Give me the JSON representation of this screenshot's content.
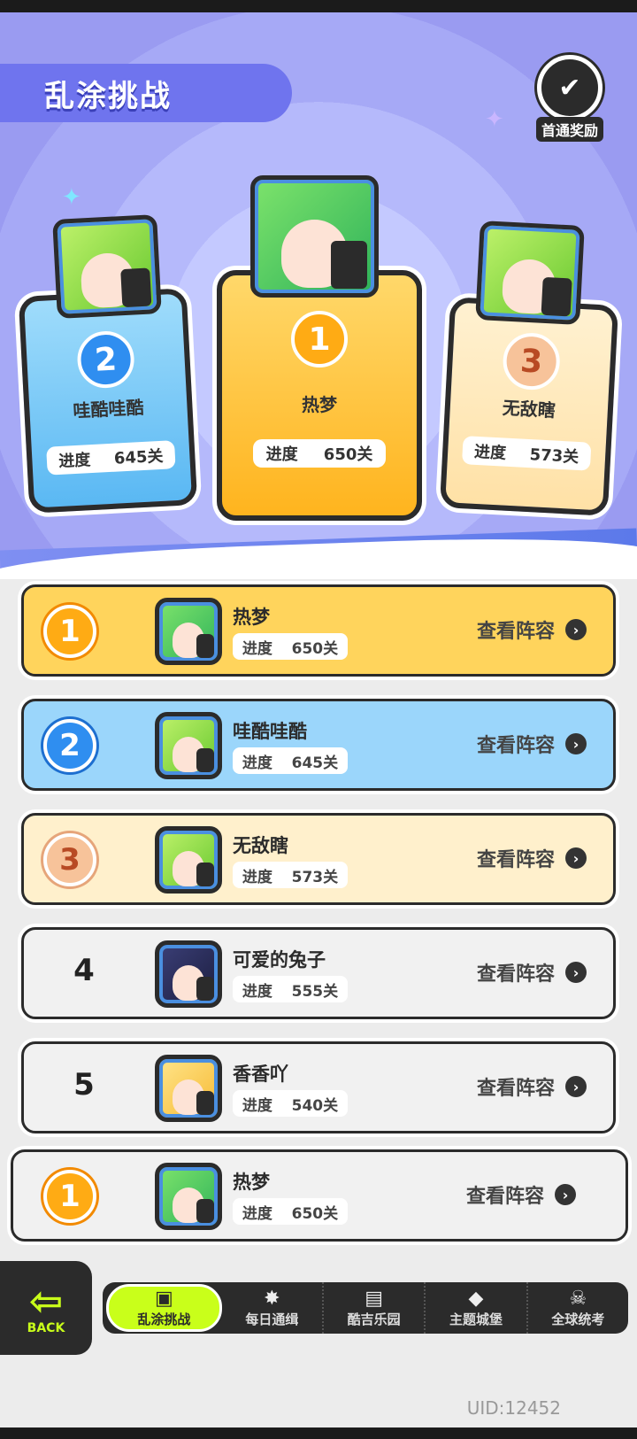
{
  "header": {
    "title": "乱涂挑战",
    "first_reward_label": "首通奖励"
  },
  "podium": [
    {
      "rank": "2",
      "name": "哇酷哇酷",
      "progress_label": "进度",
      "progress_value": "645关"
    },
    {
      "rank": "1",
      "name": "热梦",
      "progress_label": "进度",
      "progress_value": "650关"
    },
    {
      "rank": "3",
      "name": "无敌瞎",
      "progress_label": "进度",
      "progress_value": "573关"
    }
  ],
  "leaderboard": [
    {
      "rank": "1",
      "name": "热梦",
      "progress_label": "进度",
      "progress_value": "650关",
      "action": "查看阵容"
    },
    {
      "rank": "2",
      "name": "哇酷哇酷",
      "progress_label": "进度",
      "progress_value": "645关",
      "action": "查看阵容"
    },
    {
      "rank": "3",
      "name": "无敌瞎",
      "progress_label": "进度",
      "progress_value": "573关",
      "action": "查看阵容"
    },
    {
      "rank": "4",
      "name": "可爱的兔子",
      "progress_label": "进度",
      "progress_value": "555关",
      "action": "查看阵容"
    },
    {
      "rank": "5",
      "name": "香香吖",
      "progress_label": "进度",
      "progress_value": "540关",
      "action": "查看阵容"
    }
  ],
  "my_rank": {
    "rank": "1",
    "name": "热梦",
    "progress_label": "进度",
    "progress_value": "650关",
    "action": "查看阵容"
  },
  "nav": {
    "back_label": "BACK",
    "tabs": [
      {
        "label": "乱涂挑战",
        "icon": "gamepad-icon"
      },
      {
        "label": "每日通缉",
        "icon": "wanted-icon"
      },
      {
        "label": "酷吉乐园",
        "icon": "console-icon"
      },
      {
        "label": "主题城堡",
        "icon": "castle-icon"
      },
      {
        "label": "全球统考",
        "icon": "skull-icon"
      }
    ]
  },
  "uid": "UID:12452",
  "colors": {
    "gold": "#ffd45c",
    "blue": "#9bd6fb",
    "bronze": "#fff0cc",
    "accent_green": "#c9ff1a",
    "title_purple": "#6f74ee"
  }
}
